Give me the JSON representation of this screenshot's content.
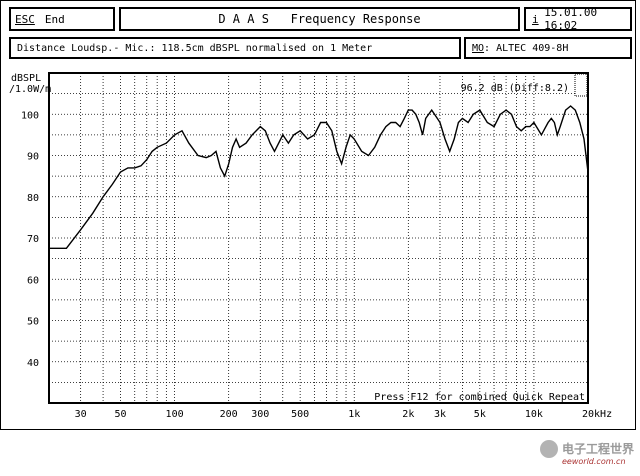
{
  "toolbar": {
    "esc_key": "ESC",
    "end_label": "End",
    "app_title": "D A A S   Frequency Response",
    "info_key": "i",
    "datetime": "15.01.00 16:02"
  },
  "infobar": {
    "measurement_info": "Distance Loudsp.- Mic.: 118.5cm dBSPL normalised on 1 Meter",
    "model_key": "MO",
    "model_value": ": ALTEC 409-8H"
  },
  "chart_data": {
    "type": "line",
    "y_unit_line1": "dBSPL",
    "y_unit_line2": "/1.0W/m",
    "ylim": [
      30,
      110
    ],
    "yticks": [
      40,
      50,
      60,
      70,
      80,
      90,
      100
    ],
    "xlim": [
      20,
      20000
    ],
    "x_scale": "log",
    "xticks": [
      {
        "v": 30,
        "label": "30"
      },
      {
        "v": 50,
        "label": "50"
      },
      {
        "v": 100,
        "label": "100"
      },
      {
        "v": 200,
        "label": "200"
      },
      {
        "v": 300,
        "label": "300"
      },
      {
        "v": 500,
        "label": "500"
      },
      {
        "v": 1000,
        "label": "1k"
      },
      {
        "v": 2000,
        "label": "2k"
      },
      {
        "v": 3000,
        "label": "3k"
      },
      {
        "v": 5000,
        "label": "5k"
      },
      {
        "v": 10000,
        "label": "10k"
      },
      {
        "v": 20000,
        "label": "20kHz"
      }
    ],
    "grid": true,
    "annotation_level": "96.2 dB (Diff:8.2)",
    "footer_hint": "Press F12 for combined Quick Repeat",
    "series": [
      {
        "x": [
          20,
          25,
          30,
          35,
          40,
          45,
          50,
          55,
          60,
          65,
          70,
          75,
          80,
          90,
          100,
          110,
          120,
          135,
          150,
          160,
          170,
          180,
          190,
          200,
          210,
          220,
          230,
          250,
          270,
          300,
          320,
          340,
          360,
          380,
          400,
          430,
          460,
          500,
          550,
          600,
          650,
          700,
          750,
          800,
          850,
          900,
          950,
          1000,
          1100,
          1200,
          1300,
          1400,
          1500,
          1600,
          1700,
          1800,
          1900,
          2000,
          2100,
          2200,
          2300,
          2400,
          2500,
          2700,
          2900,
          3000,
          3200,
          3400,
          3600,
          3800,
          4000,
          4300,
          4600,
          5000,
          5500,
          6000,
          6500,
          7000,
          7500,
          8000,
          8500,
          9000,
          9500,
          10000,
          11000,
          12000,
          12500,
          13000,
          13500,
          14000,
          15000,
          16000,
          17000,
          18000,
          19000,
          20000
        ],
        "y": [
          67.5,
          67.5,
          72,
          76,
          80,
          83,
          86,
          87,
          87,
          87.5,
          89,
          91,
          92,
          93,
          95,
          96,
          93,
          90,
          89.5,
          90,
          91,
          87,
          85,
          88,
          92,
          94,
          92,
          93,
          95,
          97,
          96,
          93,
          91,
          93,
          95,
          93,
          95,
          96,
          94,
          95,
          98,
          98,
          96,
          91,
          88,
          92,
          95,
          94,
          91,
          90,
          92,
          95,
          97,
          98,
          98,
          97,
          99,
          101,
          101,
          100,
          98,
          95,
          99,
          101,
          99,
          98,
          94,
          91,
          94,
          98,
          99,
          98,
          100,
          101,
          98,
          97,
          100,
          101,
          100,
          97,
          96,
          97,
          97,
          98,
          95,
          98,
          99,
          98,
          95,
          97,
          101,
          102,
          101,
          98,
          94,
          86
        ]
      }
    ]
  },
  "watermark": {
    "title": "电子工程世界",
    "subtitle": "eeworld.com.cn"
  }
}
